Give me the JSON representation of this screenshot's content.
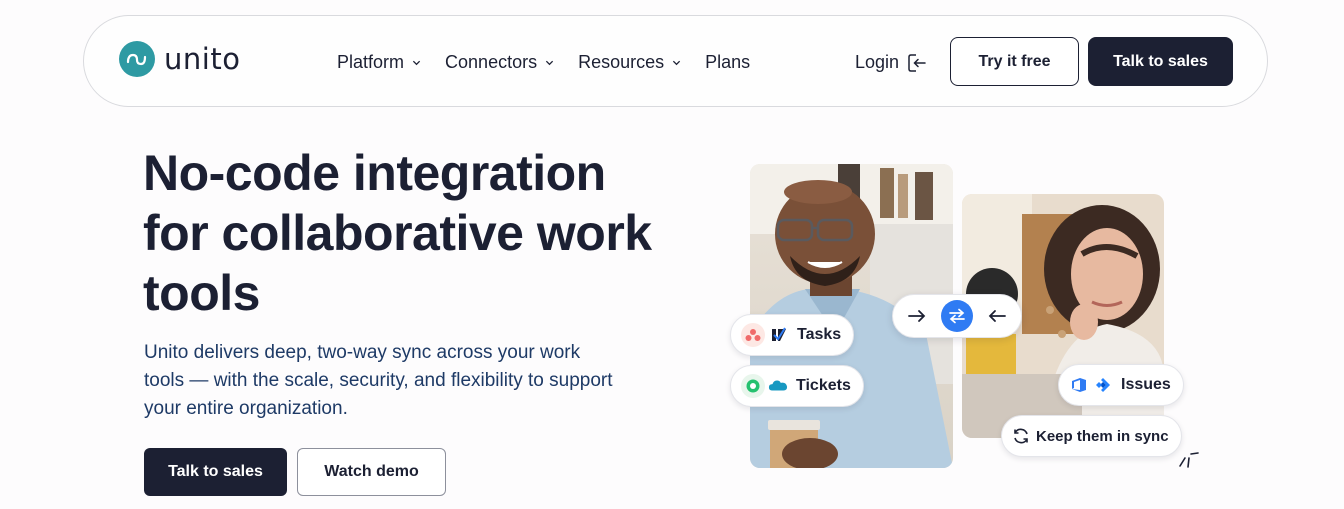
{
  "nav": {
    "logo_text": "unito",
    "menu": [
      {
        "label": "Platform",
        "has_dropdown": true
      },
      {
        "label": "Connectors",
        "has_dropdown": true
      },
      {
        "label": "Resources",
        "has_dropdown": true
      },
      {
        "label": "Plans",
        "has_dropdown": false
      }
    ],
    "login_label": "Login",
    "try_free_label": "Try it free",
    "talk_sales_label": "Talk to sales"
  },
  "hero": {
    "headline": "No-code integration for collaborative work tools",
    "subcopy": "Unito delivers deep, two-way sync across your work tools — with the scale, security, and flexibility to support your entire organization.",
    "primary_cta": "Talk to sales",
    "secondary_cta": "Watch demo"
  },
  "illustration": {
    "chips": {
      "tasks": "Tasks",
      "tickets": "Tickets",
      "issues": "Issues",
      "keep_sync": "Keep them in sync"
    }
  },
  "colors": {
    "brand_teal": "#2e9aa3",
    "navy": "#1c2033",
    "body_text": "#1e3a66",
    "sync_blue": "#2f7bf3"
  }
}
